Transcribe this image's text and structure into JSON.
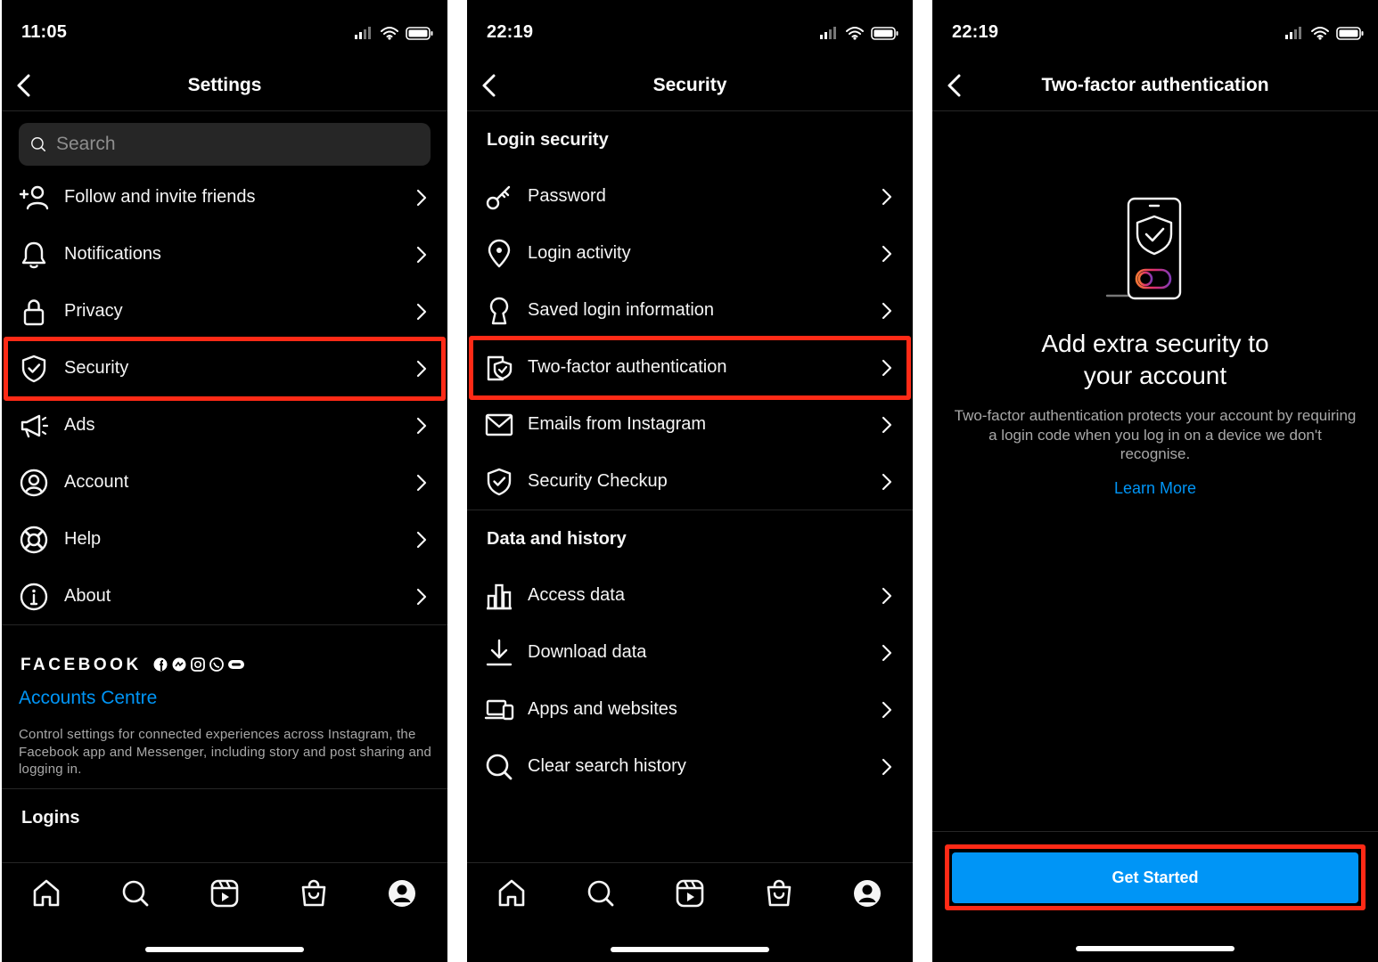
{
  "colors": {
    "background": "#000000",
    "accent_blue": "#0095f6",
    "highlight_red": "#ff2a16",
    "text": "#f5f5f5",
    "muted": "#a8a8a8"
  },
  "screen1": {
    "time": "11:05",
    "title": "Settings",
    "search_placeholder": "Search",
    "items": [
      {
        "label": "Follow and invite friends",
        "icon": "add-person-icon"
      },
      {
        "label": "Notifications",
        "icon": "bell-icon"
      },
      {
        "label": "Privacy",
        "icon": "lock-icon"
      },
      {
        "label": "Security",
        "icon": "shield-check-icon",
        "highlighted": true
      },
      {
        "label": "Ads",
        "icon": "megaphone-icon"
      },
      {
        "label": "Account",
        "icon": "user-circle-icon"
      },
      {
        "label": "Help",
        "icon": "lifebuoy-icon"
      },
      {
        "label": "About",
        "icon": "info-icon"
      }
    ],
    "facebook_brand": "FACEBOOK",
    "accounts_centre": "Accounts Centre",
    "accounts_desc": "Control settings for connected experiences across Instagram, the Facebook app and Messenger, including story and post sharing and logging in.",
    "logins_heading": "Logins"
  },
  "screen2": {
    "time": "22:19",
    "title": "Security",
    "login_section": "Login security",
    "login_items": [
      {
        "label": "Password",
        "icon": "key-icon"
      },
      {
        "label": "Login activity",
        "icon": "location-pin-icon"
      },
      {
        "label": "Saved login information",
        "icon": "keyhole-icon"
      },
      {
        "label": "Two-factor authentication",
        "icon": "two-factor-shield-icon",
        "highlighted": true
      },
      {
        "label": "Emails from Instagram",
        "icon": "envelope-icon"
      },
      {
        "label": "Security Checkup",
        "icon": "shield-check-icon"
      }
    ],
    "data_section": "Data and history",
    "data_items": [
      {
        "label": "Access data",
        "icon": "bar-chart-icon"
      },
      {
        "label": "Download data",
        "icon": "download-icon"
      },
      {
        "label": "Apps and websites",
        "icon": "devices-icon"
      },
      {
        "label": "Clear search history",
        "icon": "search-icon"
      }
    ]
  },
  "screen3": {
    "time": "22:19",
    "title": "Two-factor authentication",
    "heading": "Add extra security to your account",
    "description": "Two-factor authentication protects your account by requiring a login code when you log in on a device we don't recognise.",
    "learn_more": "Learn More",
    "cta": "Get Started"
  },
  "tabbar": [
    "home-icon",
    "search-icon",
    "reels-icon",
    "shop-icon",
    "profile-icon"
  ]
}
